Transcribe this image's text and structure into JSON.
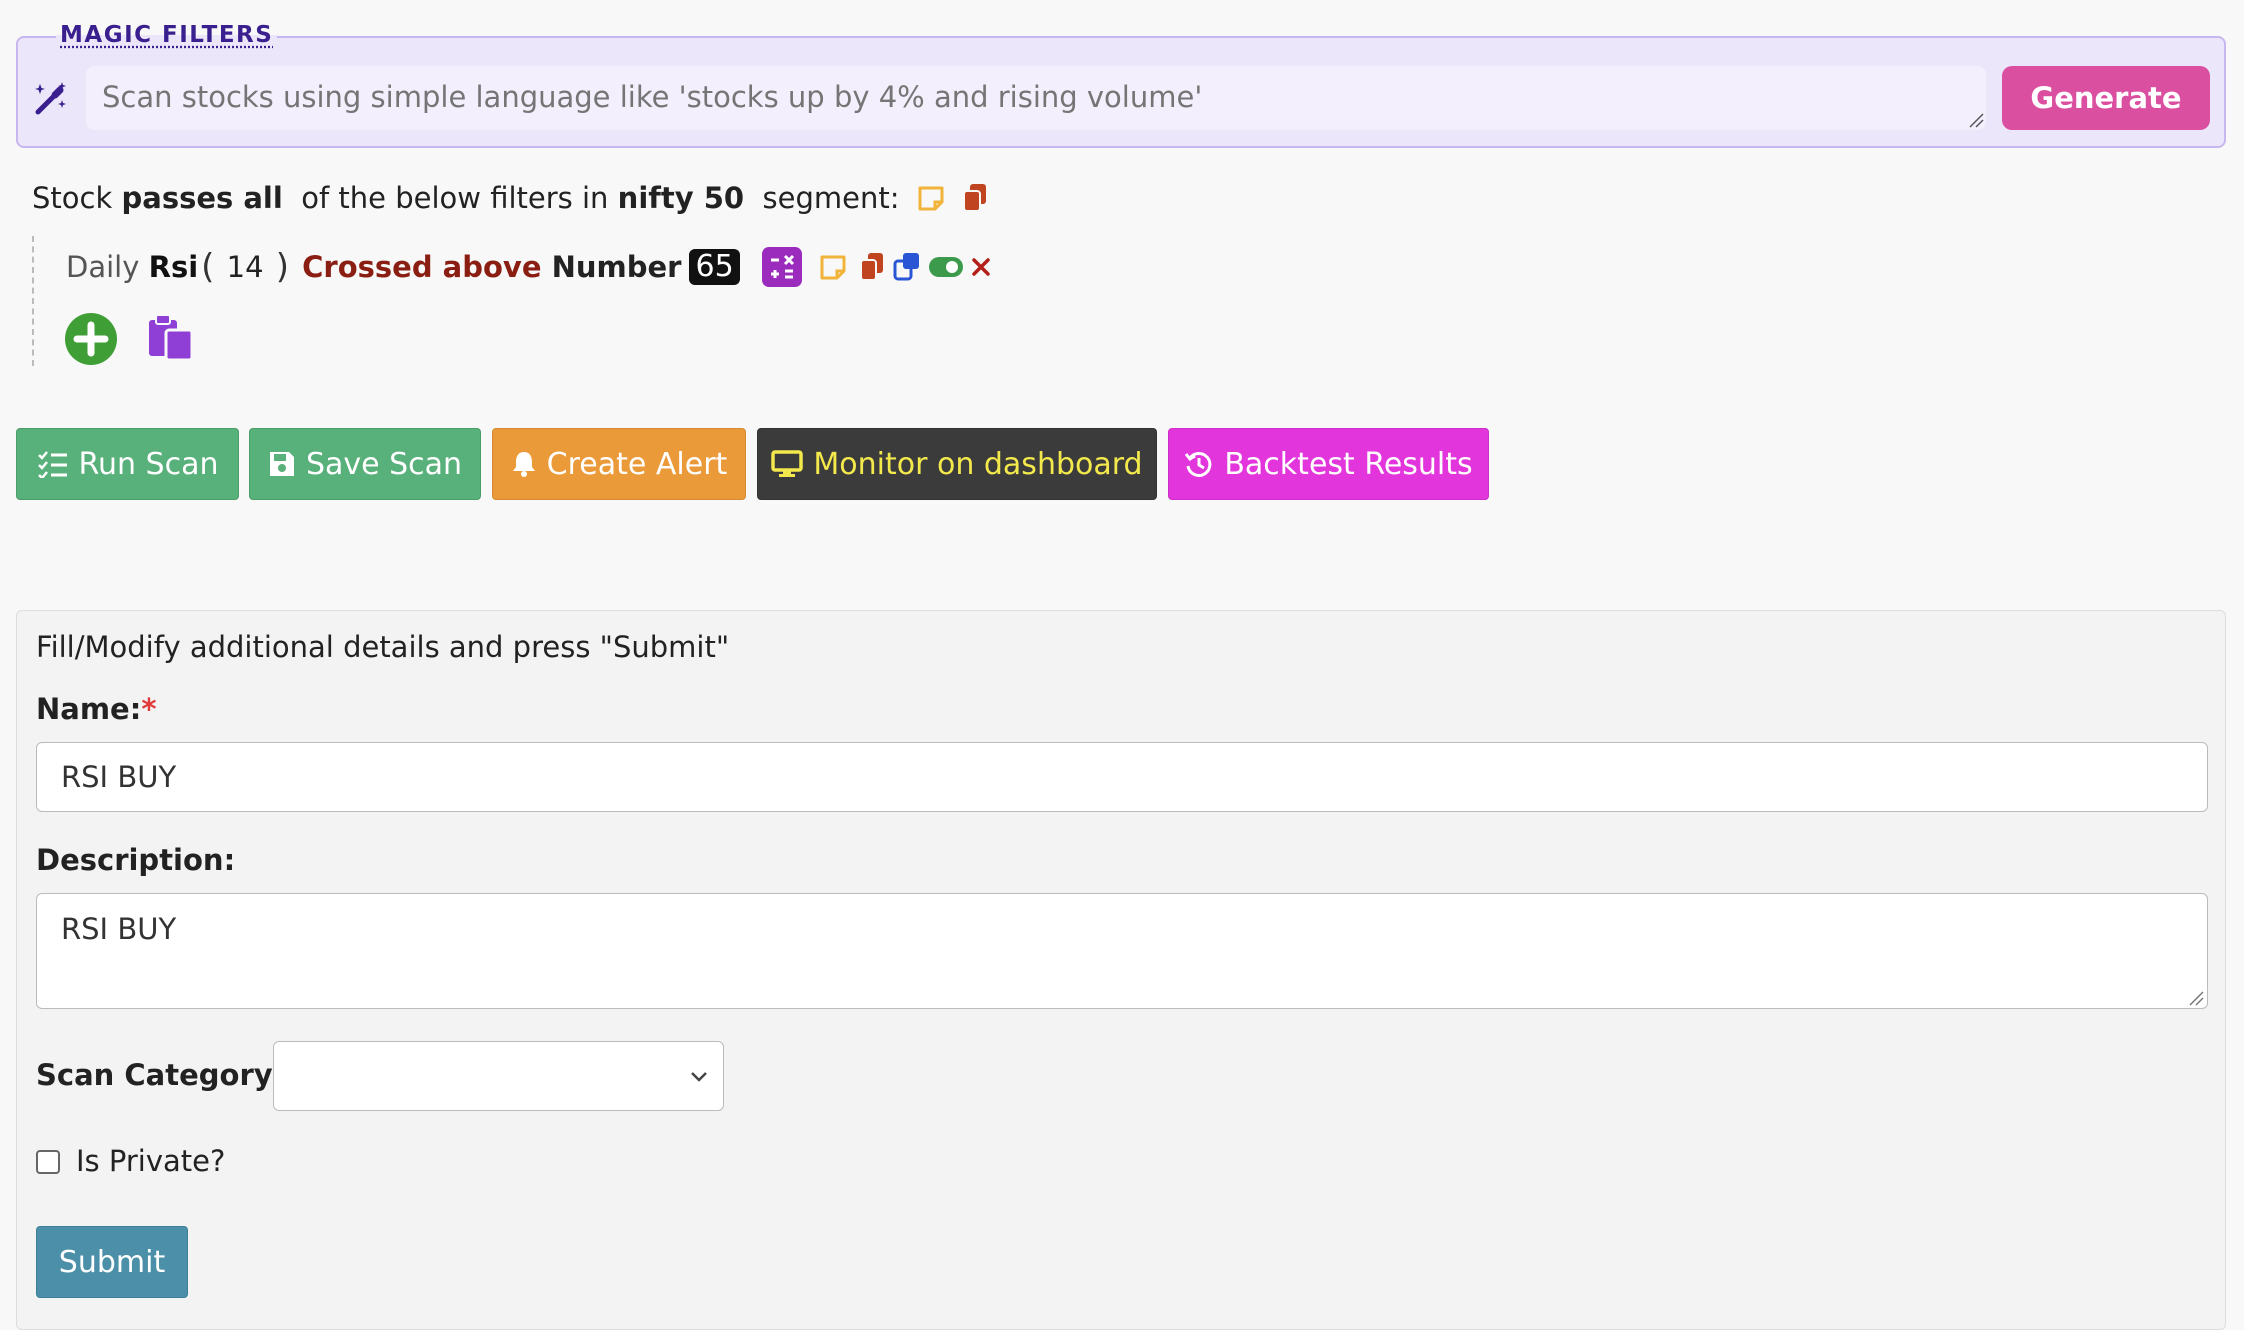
{
  "magic": {
    "legend": "MAGIC FILTERS",
    "placeholder": "Scan stocks using simple language like 'stocks up by 4% and rising volume'",
    "generate_label": "Generate"
  },
  "condition": {
    "prefix": "Stock ",
    "mode": "passes all",
    "middle": "  of the below filters in ",
    "segment": "nifty 50",
    "suffix": "  segment:"
  },
  "filter": {
    "timeframe": "Daily ",
    "indicator": "Rsi",
    "paren_open": "(",
    "period": " 14 ",
    "paren_close": ")",
    "operator": " Crossed above ",
    "compare": "Number",
    "value": "65"
  },
  "actions": {
    "run_scan": "Run Scan",
    "save_scan": "Save Scan",
    "create_alert": "Create Alert",
    "monitor": "Monitor on dashboard",
    "backtest": "Backtest Results"
  },
  "form": {
    "instruction": "Fill/Modify additional details and press \"Submit\"",
    "name_label": "Name:",
    "required_mark": "*",
    "name_value": "RSI BUY",
    "description_label": "Description:",
    "description_value": "RSI BUY",
    "category_label": "Scan Category:",
    "category_value": "",
    "private_label": "Is Private?",
    "submit_label": "Submit"
  },
  "colors": {
    "generate": "#db4fa0",
    "run": "#58b07a",
    "alert": "#eb9a3a",
    "monitor_bg": "#3b3b3b",
    "monitor_text": "#f3e84c",
    "backtest": "#e235dc",
    "submit": "#4b8fa8",
    "crossed": "#8b1e12"
  }
}
